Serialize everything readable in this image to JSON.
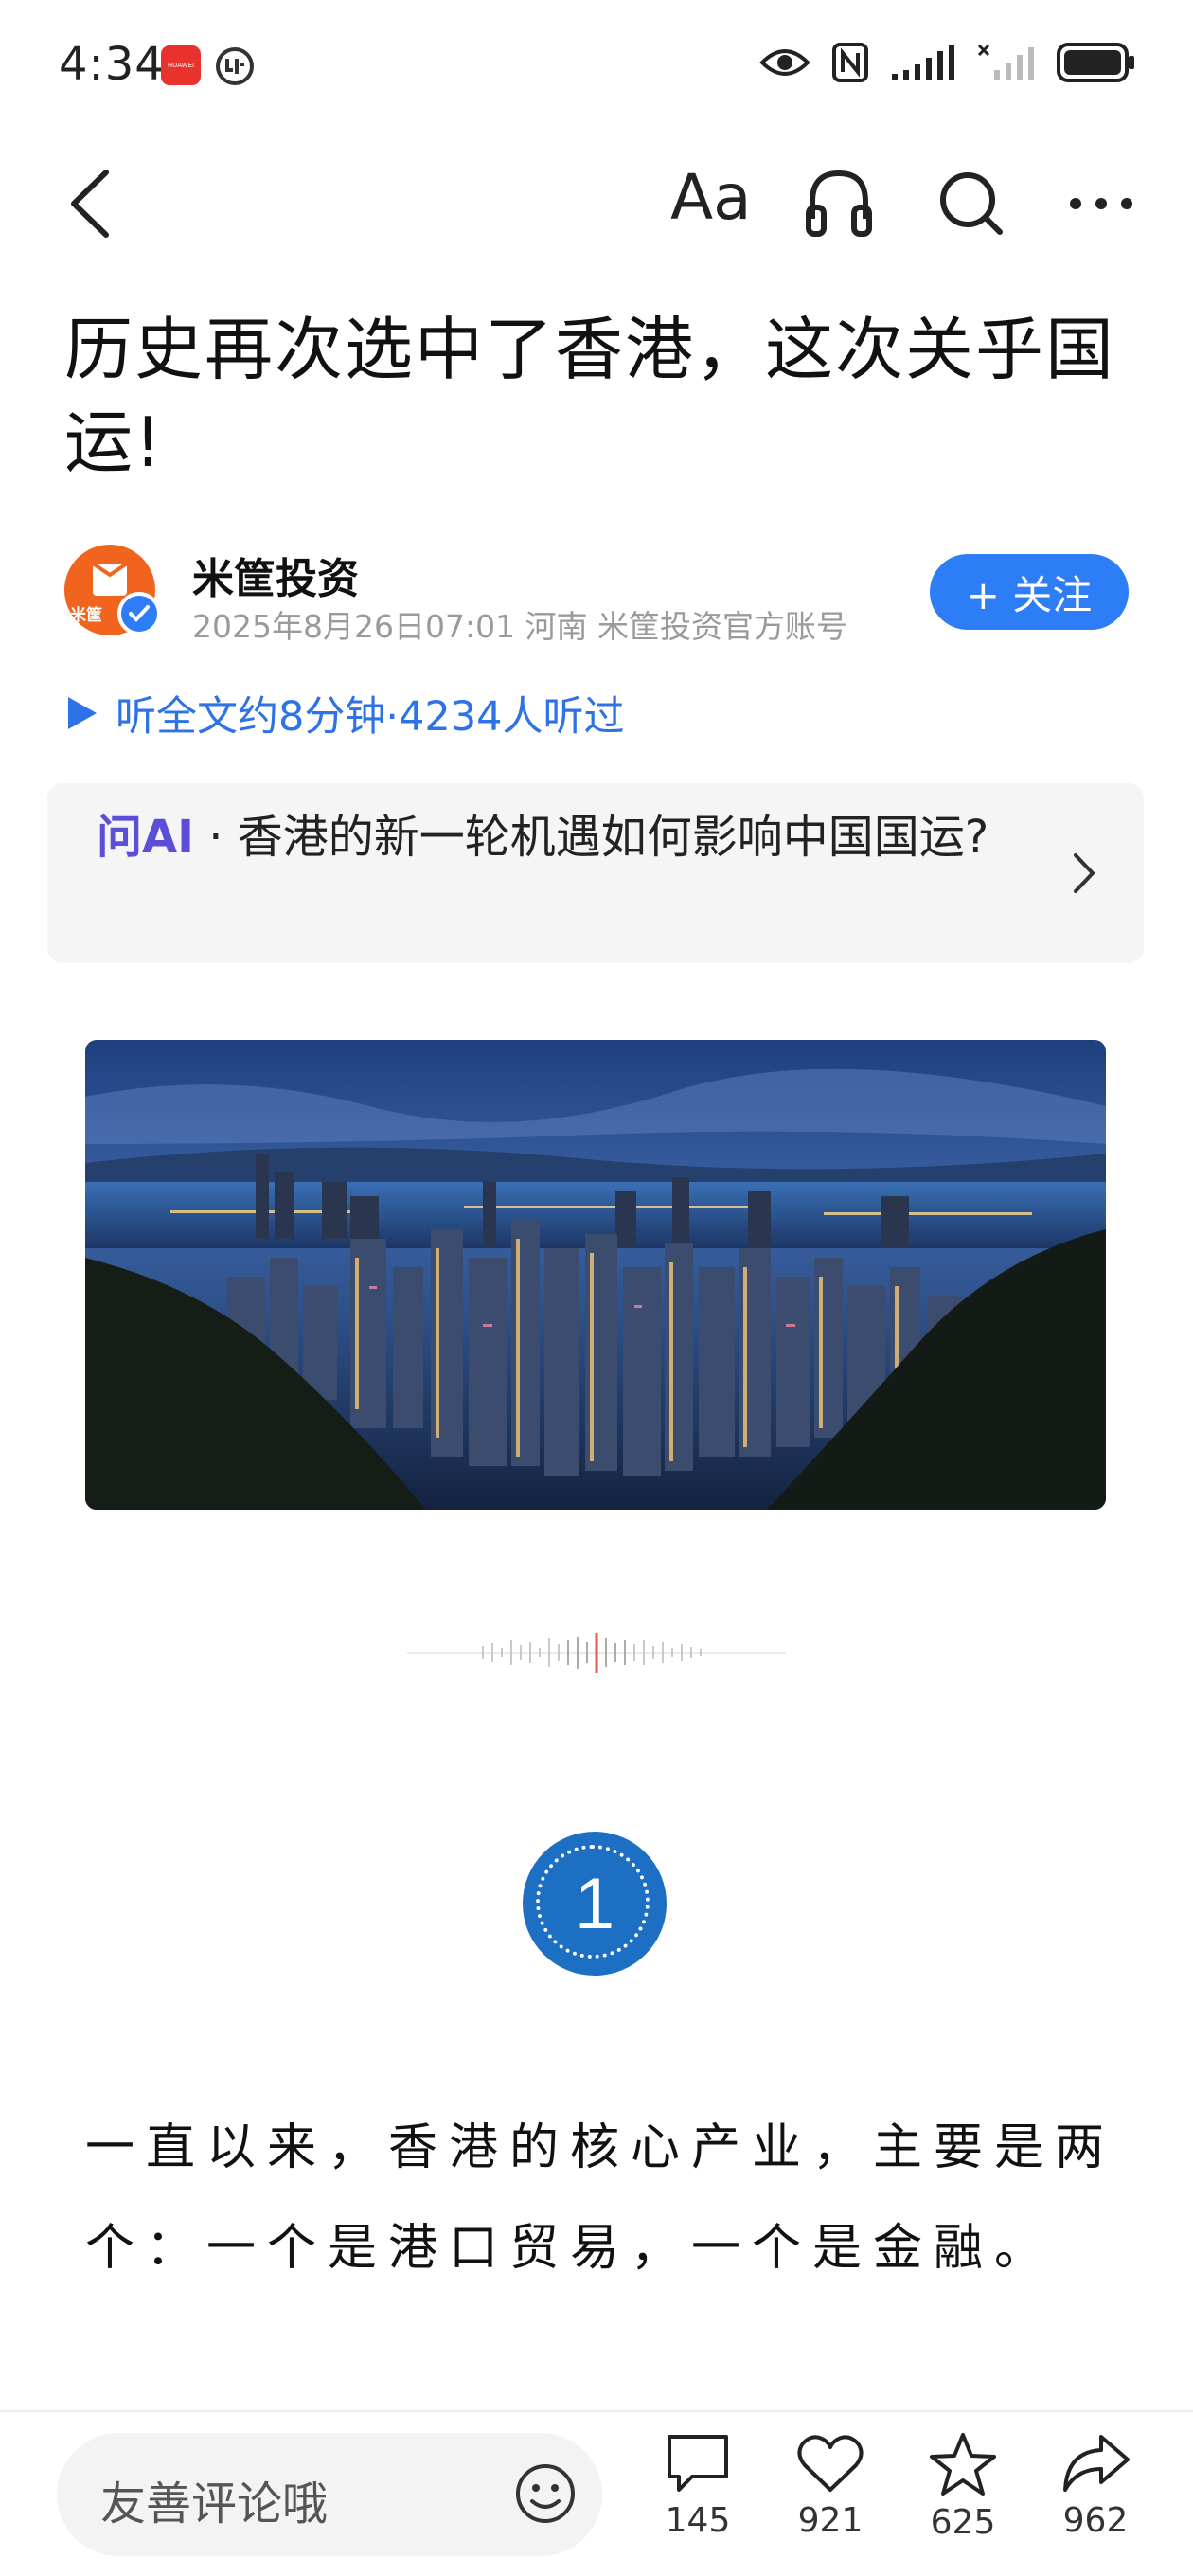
{
  "status_bar": {
    "time": "4:34",
    "huawei_badge": "HUAWEI"
  },
  "nav": {
    "font_label": "Aa"
  },
  "article": {
    "title": "历史再次选中了香港，这次关乎国运!",
    "author": {
      "name": "米筐投资",
      "avatar_text": "米筐",
      "meta": "2025年8月26日07:01 河南 米筐投资官方账号"
    },
    "follow_label": "+ 关注",
    "listen_text": "听全文约8分钟·4234人听过",
    "ask_ai": {
      "label": "问AI",
      "separator": " · ",
      "question": "香港的新一轮机遇如何影响中国国运?"
    },
    "section_number": "1",
    "paragraph": "一直以来，香港的核心产业，主要是两个：一个是港口贸易，一个是金融。"
  },
  "bottom_bar": {
    "comment_placeholder": "友善评论哦",
    "comments": "145",
    "likes": "921",
    "favorites": "625",
    "shares": "962"
  },
  "colors": {
    "accent_blue": "#2d7df6",
    "ai_purple": "#5a4fd6",
    "section_blue": "#1d6fc4"
  }
}
